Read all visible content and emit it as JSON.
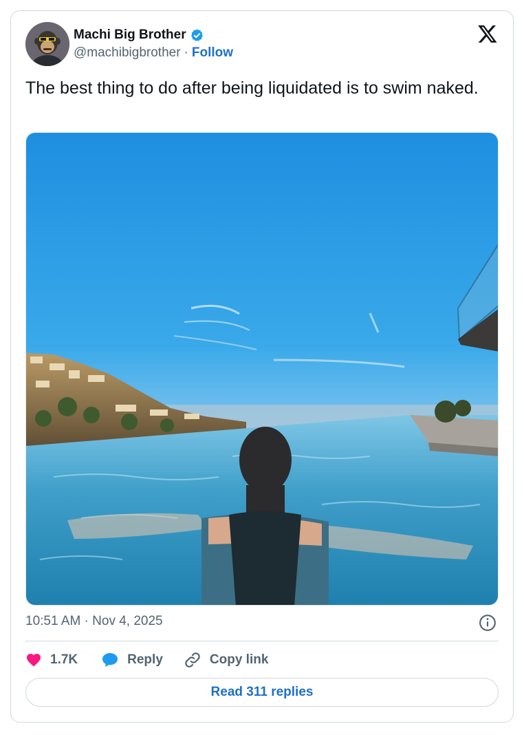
{
  "author": {
    "display_name": "Machi Big Brother",
    "handle": "@machibigbrother",
    "separator": "·",
    "follow_label": "Follow"
  },
  "tweet": {
    "text": "The best thing to do after being liquidated is to swim naked.",
    "timestamp": "10:51 AM · Nov 4, 2025"
  },
  "actions": {
    "like_count": "1.7K",
    "reply_label": "Reply",
    "copy_link_label": "Copy link"
  },
  "read_replies_label": "Read 311 replies",
  "icons": {
    "avatar": "avatar-bored-ape",
    "verified": "verified-badge-icon",
    "platform": "x-logo-icon",
    "info": "info-icon",
    "like": "heart-icon",
    "reply": "speech-bubble-icon",
    "copy": "link-icon"
  },
  "colors": {
    "accent": "#1d70c8",
    "verified": "#1d9bf0",
    "like": "#f91880",
    "text": "#0f1419",
    "muted": "#536471",
    "border": "#cfd9de"
  }
}
